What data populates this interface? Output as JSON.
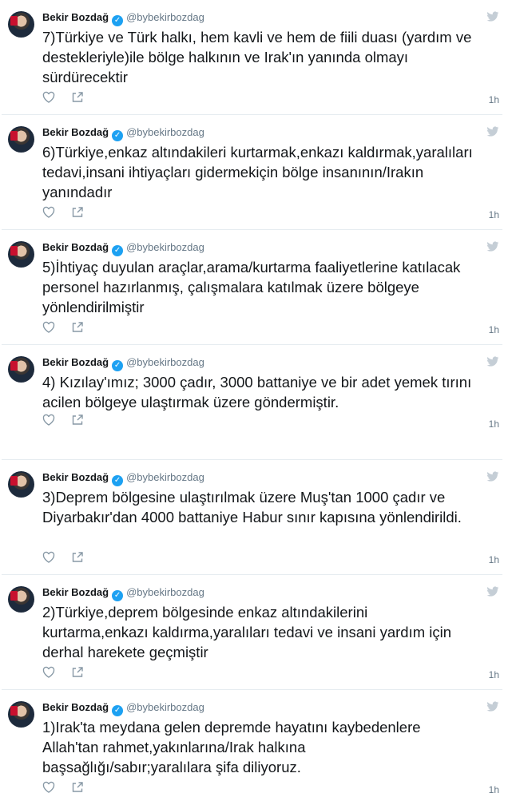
{
  "colors": {
    "verified": "#1da1f2",
    "muted": "#657786",
    "text": "#14171a",
    "divider": "#e6ecf0"
  },
  "tweets": [
    {
      "name": "Bekir Bozdağ",
      "handle": "@bybekirbozdag",
      "text": "7)Türkiye ve Türk halkı, hem kavli ve hem de fiili duası (yardım ve destekleriyle)ile bölge halkının ve Irak'ın yanında olmayı sürdürecektir",
      "time": "1h"
    },
    {
      "name": "Bekir Bozdağ",
      "handle": "@bybekirbozdag",
      "text": "6)Türkiye,enkaz altındakileri kurtarmak,enkazı kaldırmak,yaralıları tedavi,insani ihtiyaçları gidermekiçin bölge insanının/Irakın yanındadır",
      "time": "1h"
    },
    {
      "name": "Bekir Bozdağ",
      "handle": "@bybekirbozdag",
      "text": "5)İhtiyaç duyulan araçlar,arama/kurtarma faaliyetlerine katılacak personel hazırlanmış, çalışmalara katılmak üzere bölgeye yönlendirilmiştir",
      "time": "1h"
    },
    {
      "name": "Bekir Bozdağ",
      "handle": "@bybekirbozdag",
      "text": "4) Kızılay'ımız; 3000 çadır, 3000 battaniye ve bir adet yemek tırını acilen bölgeye ulaştırmak üzere göndermiştir.",
      "time": "1h"
    },
    {
      "name": "Bekir Bozdağ",
      "handle": "@bybekirbozdag",
      "text": "3)Deprem bölgesine ulaştırılmak üzere Muş'tan 1000 çadır ve Diyarbakır'dan 4000 battaniye Habur sınır kapısına yönlendirildi.",
      "time": "1h"
    },
    {
      "name": "Bekir Bozdağ",
      "handle": "@bybekirbozdag",
      "text": "2)Türkiye,deprem bölgesinde enkaz altındakilerini kurtarma,enkazı kaldırma,yaralıları tedavi ve insani yardım için derhal harekete geçmiştir",
      "time": "1h"
    },
    {
      "name": "Bekir Bozdağ",
      "handle": "@bybekirbozdag",
      "text": "1)Irak'ta meydana gelen depremde hayatını kaybedenlere Allah'tan rahmet,yakınlarına/Irak halkına başsağlığı/sabır;yaralılara şifa diliyoruz.",
      "time": "1h"
    }
  ],
  "icons": {
    "verified": "verified-badge-icon",
    "platform": "twitter-bird-icon",
    "like": "heart-icon",
    "share": "share-icon"
  }
}
